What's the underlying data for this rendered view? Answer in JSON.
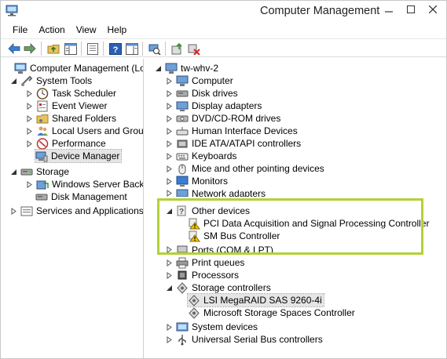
{
  "window": {
    "title": "Computer Management"
  },
  "menu": [
    "File",
    "Action",
    "View",
    "Help"
  ],
  "left_tree": {
    "root": "Computer Management (Local",
    "system_tools": "System Tools",
    "task_scheduler": "Task Scheduler",
    "event_viewer": "Event Viewer",
    "shared_folders": "Shared Folders",
    "local_users": "Local Users and Groups",
    "performance": "Performance",
    "device_manager": "Device Manager",
    "storage": "Storage",
    "wsb": "Windows Server Backup",
    "disk_mgmt": "Disk Management",
    "services": "Services and Applications"
  },
  "right_tree": {
    "root": "tw-whv-2",
    "computer": "Computer",
    "disk_drives": "Disk drives",
    "display_adapters": "Display adapters",
    "dvd": "DVD/CD-ROM drives",
    "hid": "Human Interface Devices",
    "ide": "IDE ATA/ATAPI controllers",
    "keyboards": "Keyboards",
    "mice": "Mice and other pointing devices",
    "monitors": "Monitors",
    "network": "Network adapters",
    "other": "Other devices",
    "pci": "PCI Data Acquisition and Signal Processing Controller",
    "smbus": "SM Bus Controller",
    "ports": "Ports (COM & LPT)",
    "print_queues": "Print queues",
    "processors": "Processors",
    "storage_ctrl": "Storage controllers",
    "lsi": "LSI MegaRAID SAS 9260-4i",
    "ms_storage": "Microsoft Storage Spaces Controller",
    "system_devices": "System devices",
    "usb": "Universal Serial Bus controllers"
  },
  "colors": {
    "highlight": "#b2d235",
    "warning": "#f2c200"
  }
}
